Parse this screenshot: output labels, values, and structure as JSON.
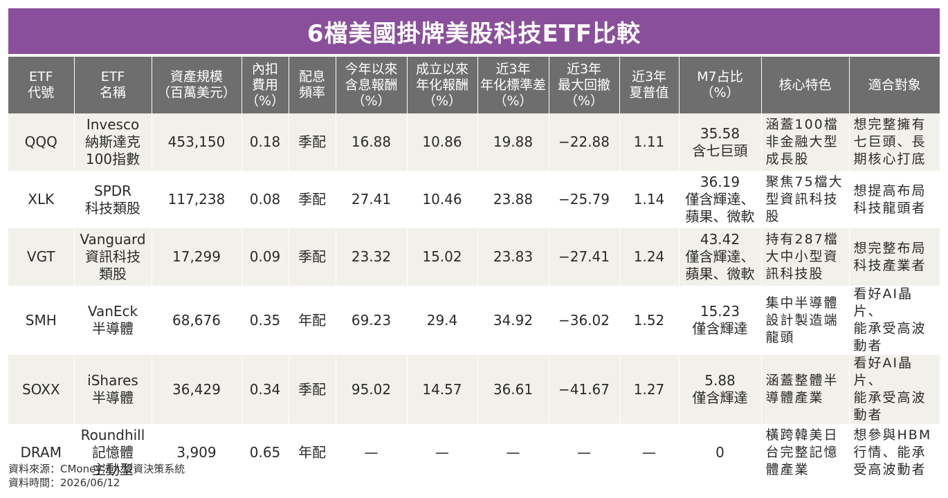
{
  "title": "6檔美國掛牌美股科技ETF比較",
  "headers": [
    "ETF\n代號",
    "ETF\n名稱",
    "資產規模\n（百萬美元）",
    "內扣\n費用\n（%）",
    "配息\n頻率",
    "今年以來\n含息報酬\n（%）",
    "成立以來\n年化報酬\n（%）",
    "近3年\n年化標準差\n（%）",
    "近3年\n最大回撤\n（%）",
    "近3年\n夏普值",
    "M7占比\n（%）",
    "核心特色",
    "適合對象"
  ],
  "rows": [
    {
      "code": "QQQ",
      "name": "Invesco\n納斯達克\n100指數",
      "aum": "453,150",
      "fee": "0.18",
      "freq": "季配",
      "ytd": "16.88",
      "since": "10.86",
      "std": "19.88",
      "mdd": "−22.88",
      "sharpe": "1.11",
      "m7": "35.58\n含七巨頭",
      "feature": "涵蓋100檔\n非金融大型\n成長股",
      "audience": "想完整擁有\n七巨頭、長\n期核心打底"
    },
    {
      "code": "XLK",
      "name": "SPDR\n科技類股",
      "aum": "117,238",
      "fee": "0.08",
      "freq": "季配",
      "ytd": "27.41",
      "since": "10.46",
      "std": "23.88",
      "mdd": "−25.79",
      "sharpe": "1.14",
      "m7": "36.19\n僅含輝達、\n蘋果、微軟",
      "feature": "聚焦75檔大\n型資訊科技\n股",
      "audience": "想提高布局\n科技龍頭者"
    },
    {
      "code": "VGT",
      "name": "Vanguard\n資訊科技\n類股",
      "aum": "17,299",
      "fee": "0.09",
      "freq": "季配",
      "ytd": "23.32",
      "since": "15.02",
      "std": "23.83",
      "mdd": "−27.41",
      "sharpe": "1.24",
      "m7": "43.42\n僅含輝達、\n蘋果、微軟",
      "feature": "持有287檔\n大中小型資\n訊科技股",
      "audience": "想完整布局\n科技產業者"
    },
    {
      "code": "SMH",
      "name": "VanEck\n半導體",
      "aum": "68,676",
      "fee": "0.35",
      "freq": "年配",
      "ytd": "69.23",
      "since": "29.4",
      "std": "34.92",
      "mdd": "−36.02",
      "sharpe": "1.52",
      "m7": "15.23\n僅含輝達",
      "feature": "集中半導體\n設計製造端\n龍頭",
      "audience": "看好AI晶片、\n能承受高波\n動者"
    },
    {
      "code": "SOXX",
      "name": "iShares\n半導體",
      "aum": "36,429",
      "fee": "0.34",
      "freq": "季配",
      "ytd": "95.02",
      "since": "14.57",
      "std": "36.61",
      "mdd": "−41.67",
      "sharpe": "1.27",
      "m7": "5.88\n僅含輝達",
      "feature": "涵蓋整體半\n導體產業",
      "audience": "看好AI晶片、\n能承受高波\n動者"
    },
    {
      "code": "DRAM",
      "name": "Roundhill\n記憶體\n主動型",
      "aum": "3,909",
      "fee": "0.65",
      "freq": "年配",
      "ytd": "—",
      "since": "—",
      "std": "—",
      "mdd": "—",
      "sharpe": "—",
      "m7": "0",
      "feature": "橫跨韓美日\n台完整記憶\n體產業",
      "audience": "想參與HBM\n行情、能承\n受高波動者"
    }
  ],
  "footer": {
    "source": "資料來源：CMoney法人投資決策系統",
    "time": "資料時間：2026/06/12"
  },
  "colors": {
    "title_bg": "#8a4f9b",
    "header_bg": "#6e6e6e",
    "row_alt_bg": "#f2f0ea"
  }
}
